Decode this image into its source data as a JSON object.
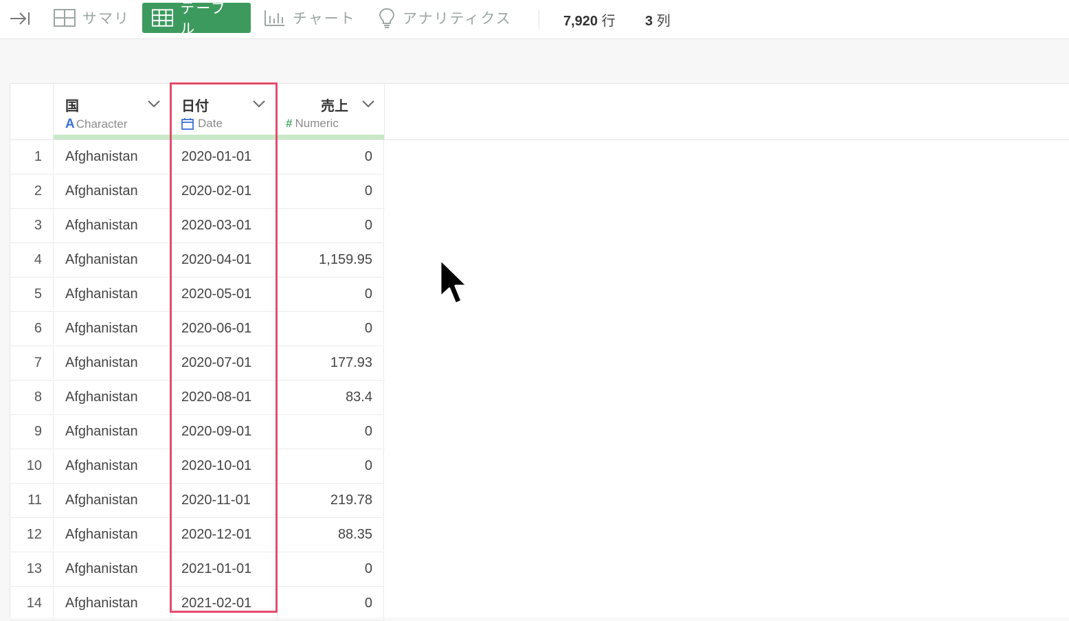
{
  "toolbar": {
    "tabs": [
      {
        "label": "サマリ",
        "icon": "grid-icon"
      },
      {
        "label": "テーブル",
        "icon": "table-icon"
      },
      {
        "label": "チャート",
        "icon": "bar-chart-icon"
      },
      {
        "label": "アナリティクス",
        "icon": "lightbulb-icon"
      }
    ],
    "active_tab": "テーブル",
    "rows_count": "7,920",
    "rows_label": "行",
    "cols_count": "3",
    "cols_label": "列"
  },
  "table": {
    "columns": [
      {
        "name": "国",
        "type": "Character",
        "type_icon": "A"
      },
      {
        "name": "日付",
        "type": "Date",
        "type_icon": "calendar-icon"
      },
      {
        "name": "売上",
        "type": "Numeric",
        "type_icon": "#"
      }
    ],
    "rows": [
      {
        "idx": "1",
        "country": "Afghanistan",
        "date": "2020-01-01",
        "sales": "0"
      },
      {
        "idx": "2",
        "country": "Afghanistan",
        "date": "2020-02-01",
        "sales": "0"
      },
      {
        "idx": "3",
        "country": "Afghanistan",
        "date": "2020-03-01",
        "sales": "0"
      },
      {
        "idx": "4",
        "country": "Afghanistan",
        "date": "2020-04-01",
        "sales": "1,159.95"
      },
      {
        "idx": "5",
        "country": "Afghanistan",
        "date": "2020-05-01",
        "sales": "0"
      },
      {
        "idx": "6",
        "country": "Afghanistan",
        "date": "2020-06-01",
        "sales": "0"
      },
      {
        "idx": "7",
        "country": "Afghanistan",
        "date": "2020-07-01",
        "sales": "177.93"
      },
      {
        "idx": "8",
        "country": "Afghanistan",
        "date": "2020-08-01",
        "sales": "83.4"
      },
      {
        "idx": "9",
        "country": "Afghanistan",
        "date": "2020-09-01",
        "sales": "0"
      },
      {
        "idx": "10",
        "country": "Afghanistan",
        "date": "2020-10-01",
        "sales": "0"
      },
      {
        "idx": "11",
        "country": "Afghanistan",
        "date": "2020-11-01",
        "sales": "219.78"
      },
      {
        "idx": "12",
        "country": "Afghanistan",
        "date": "2020-12-01",
        "sales": "88.35"
      },
      {
        "idx": "13",
        "country": "Afghanistan",
        "date": "2021-01-01",
        "sales": "0"
      },
      {
        "idx": "14",
        "country": "Afghanistan",
        "date": "2021-02-01",
        "sales": "0"
      }
    ]
  },
  "colors": {
    "accent": "#3d9a5e",
    "highlight": "#e24b6b",
    "header_bar": "#c9e8c7",
    "character_type": "#3a6fd8",
    "date_type": "#3a6fd8",
    "numeric_type": "#4caf6a"
  }
}
